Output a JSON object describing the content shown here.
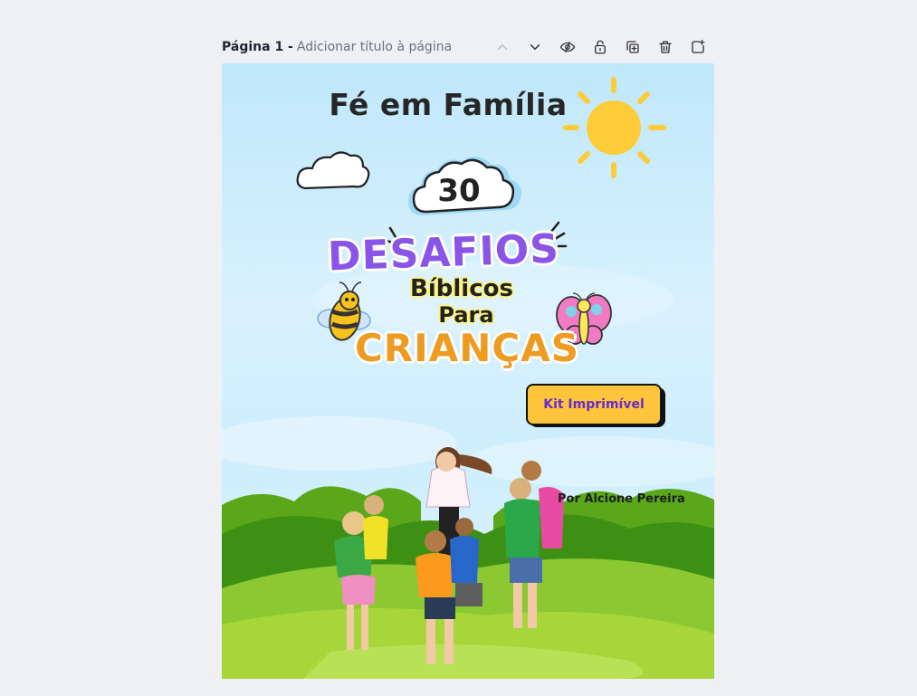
{
  "header": {
    "page_label": "Página 1",
    "separator": " - ",
    "title_placeholder": "Adicionar título à página"
  },
  "toolbar": [
    {
      "icon": "chevron-up-icon"
    },
    {
      "icon": "chevron-down-icon"
    },
    {
      "icon": "eye-off-icon"
    },
    {
      "icon": "unlock-icon"
    },
    {
      "icon": "duplicate-icon"
    },
    {
      "icon": "trash-icon"
    },
    {
      "icon": "add-page-icon"
    }
  ],
  "cover": {
    "heading": "Fé em Família",
    "number": "30",
    "line1": "DESAFIOS",
    "line2": "Bíblicos",
    "line3": "Para",
    "line4": "CRIANÇAS",
    "cta": "Kit Imprimível",
    "author": "Por Alcione Pereira"
  },
  "colors": {
    "sky": "#cdeefc",
    "accent_purple": "#8a55e6",
    "accent_orange": "#ee9b21",
    "button_yellow": "#fdc43c",
    "grass": "#7cc21a"
  }
}
